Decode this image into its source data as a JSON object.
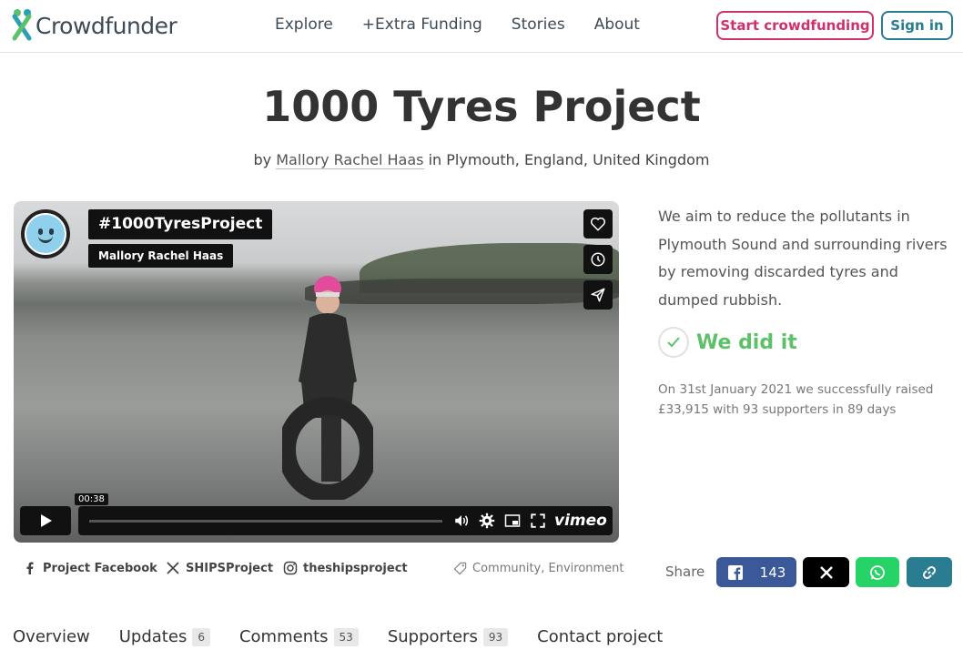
{
  "header": {
    "logo_text": "Crowdfunder",
    "nav": [
      "Explore",
      "+Extra Funding",
      "Stories",
      "About"
    ],
    "start_label": "Start crowdfunding",
    "signin_label": "Sign in",
    "accent_color": "#d0306b",
    "secondary_color": "#2a7c91"
  },
  "project": {
    "title": "1000 Tyres Project",
    "by_prefix": "by",
    "author": "Mallory Rachel Haas",
    "location_prefix": "in",
    "location": "Plymouth, England, United Kingdom"
  },
  "video": {
    "title": "#1000TyresProject",
    "author": "Mallory Rachel Haas",
    "timestamp": "00:38",
    "brand": "vimeo",
    "icons": [
      "heart-icon",
      "clock-icon",
      "share-plane-icon",
      "play-icon",
      "volume-icon",
      "settings-icon",
      "pip-icon",
      "fullscreen-icon"
    ]
  },
  "summary": {
    "description": "We aim to reduce the pollutants in Plymouth Sound and surrounding rivers by removing discarded tyres and dumped rubbish.",
    "status": "We did it",
    "status_color": "#5cc169",
    "raised_text": "On 31st January 2021 we successfully raised £33,915 with 93 supporters in 89 days"
  },
  "social": {
    "facebook": "Project Facebook",
    "x": "SHIPSProject",
    "instagram": "theshipsproject",
    "tags": "Community, Environment"
  },
  "share": {
    "label": "Share",
    "facebook_count": "143",
    "facebook_color": "#3b5998",
    "x_color": "#000000",
    "whatsapp_color": "#25d366",
    "link_color": "#2a7c91"
  },
  "tabs": [
    {
      "label": "Overview",
      "count": ""
    },
    {
      "label": "Updates",
      "count": "6"
    },
    {
      "label": "Comments",
      "count": "53"
    },
    {
      "label": "Supporters",
      "count": "93"
    },
    {
      "label": "Contact project",
      "count": ""
    }
  ]
}
